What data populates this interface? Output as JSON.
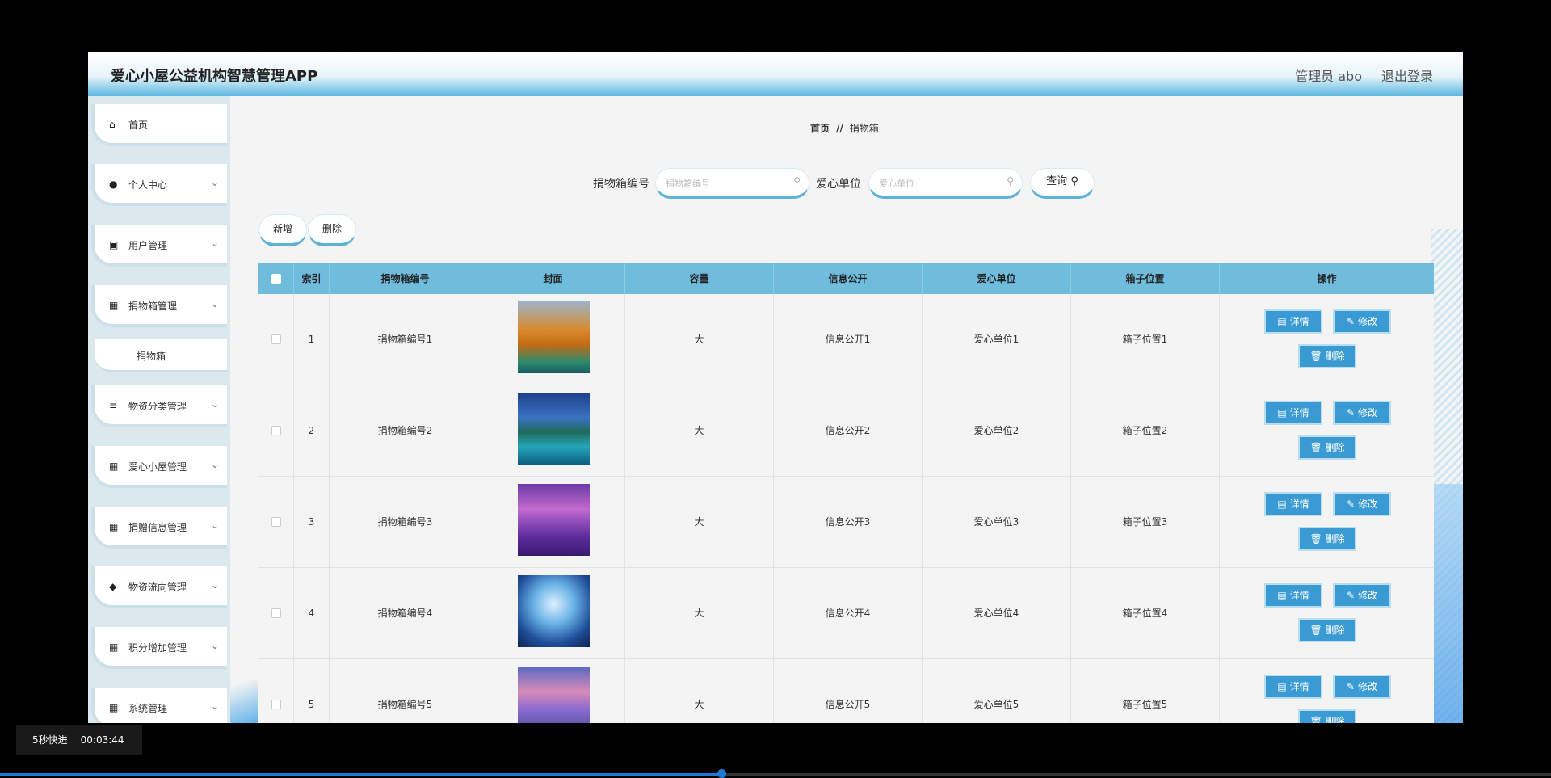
{
  "app_title": "爱心小屋公益机构智慧管理APP",
  "header": {
    "admin_label": "管理员 abo",
    "logout_label": "退出登录"
  },
  "sidebar": {
    "items": [
      {
        "label": "首页",
        "icon": "home-icon"
      },
      {
        "label": "个人中心",
        "icon": "user-icon"
      },
      {
        "label": "用户管理",
        "icon": "chart-icon"
      },
      {
        "label": "捐物箱管理",
        "icon": "grid-icon"
      },
      {
        "label": "物资分类管理",
        "icon": "list-icon"
      },
      {
        "label": "爱心小屋管理",
        "icon": "grid-icon"
      },
      {
        "label": "捐赠信息管理",
        "icon": "grid9-icon"
      },
      {
        "label": "物资流向管理",
        "icon": "location-icon"
      },
      {
        "label": "积分增加管理",
        "icon": "grid-icon"
      },
      {
        "label": "系统管理",
        "icon": "grid-icon"
      }
    ],
    "sub_item": "捐物箱"
  },
  "breadcrumb": {
    "home": "首页",
    "sep": "//",
    "current": "捐物箱"
  },
  "search": {
    "box_code_label": "捐物箱编号",
    "box_code_placeholder": "捐物箱编号",
    "unit_label": "爱心单位",
    "unit_placeholder": "爱心单位",
    "query_label": "查询"
  },
  "actions": {
    "add_label": "新增",
    "delete_label": "删除"
  },
  "table": {
    "headers": [
      "索引",
      "捐物箱编号",
      "封面",
      "容量",
      "信息公开",
      "爱心单位",
      "箱子位置",
      "操作"
    ],
    "rows": [
      {
        "index": "1",
        "code": "捐物箱编号1",
        "capacity": "大",
        "info": "信息公开1",
        "unit": "爱心单位1",
        "location": "箱子位置1"
      },
      {
        "index": "2",
        "code": "捐物箱编号2",
        "capacity": "大",
        "info": "信息公开2",
        "unit": "爱心单位2",
        "location": "箱子位置2"
      },
      {
        "index": "3",
        "code": "捐物箱编号3",
        "capacity": "大",
        "info": "信息公开3",
        "unit": "爱心单位3",
        "location": "箱子位置3"
      },
      {
        "index": "4",
        "code": "捐物箱编号4",
        "capacity": "大",
        "info": "信息公开4",
        "unit": "爱心单位4",
        "location": "箱子位置4"
      },
      {
        "index": "5",
        "code": "捐物箱编号5",
        "capacity": "大",
        "info": "信息公开5",
        "unit": "爱心单位5",
        "location": "箱子位置5"
      }
    ],
    "op_labels": {
      "detail": "详情",
      "edit": "修改",
      "delete": "删除"
    }
  },
  "video": {
    "label": "5秒快进",
    "time": "00:03:44",
    "progress": 0.465
  },
  "colors": {
    "accent": "#3a9bd4",
    "header_row": "#6fbcdd"
  }
}
